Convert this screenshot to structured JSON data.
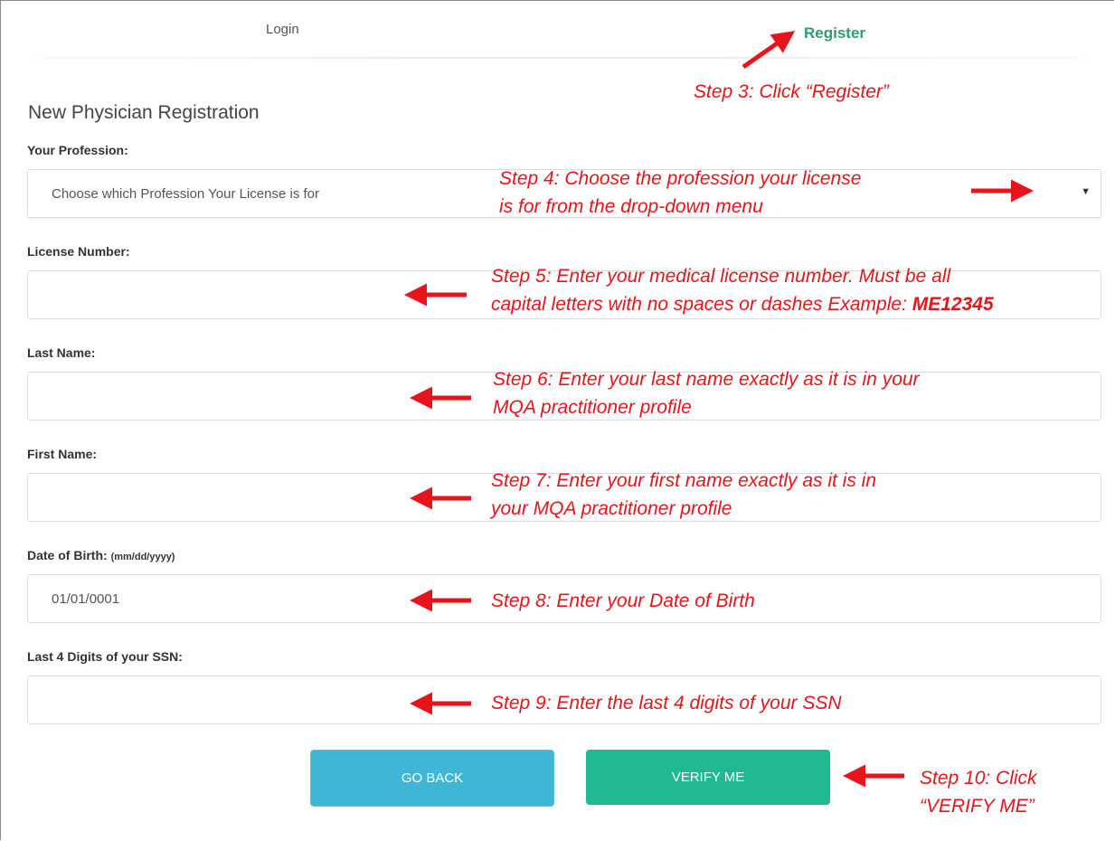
{
  "tabs": {
    "login": "Login",
    "register": "Register"
  },
  "page_title": "New Physician Registration",
  "form": {
    "profession": {
      "label": "Your Profession:",
      "value": "Choose which Profession Your License is for"
    },
    "license": {
      "label": "License Number:",
      "value": ""
    },
    "last_name": {
      "label": "Last Name:",
      "value": ""
    },
    "first_name": {
      "label": "First Name:",
      "value": ""
    },
    "dob": {
      "label": "Date of Birth:",
      "hint": "(mm/dd/yyyy)",
      "value": "01/01/0001"
    },
    "ssn": {
      "label": "Last 4 Digits of your SSN:",
      "value": ""
    }
  },
  "buttons": {
    "go_back": "GO BACK",
    "verify": "VERIFY ME"
  },
  "annotations": {
    "step3": "Step 3: Click “Register”",
    "step4_line1": "Step 4: Choose the profession your license",
    "step4_line2": "is for from the drop-down menu",
    "step5_line1": "Step 5: Enter your medical license number. Must be all",
    "step5_line2": "capital letters with no spaces or dashes Example: ",
    "step5_example": "ME12345",
    "step6_line1": "Step 6: Enter your last name exactly as it is in your",
    "step6_line2": "MQA practitioner profile",
    "step7_line1": "Step 7: Enter your first name exactly as it is in",
    "step7_line2": "your MQA practitioner profile",
    "step8": "Step 8: Enter your Date of Birth",
    "step9": "Step 9: Enter the last 4 digits of your SSN",
    "step10_line1": "Step 10: Click",
    "step10_line2": "“VERIFY ME”"
  },
  "colors": {
    "annotation": "#e8141b",
    "register_tab": "#2e9d6e",
    "go_back": "#3fb6d5",
    "verify": "#21b894"
  },
  "icons": {
    "dropdown": "caret-down-icon",
    "arrows": "red-arrow-icon"
  }
}
